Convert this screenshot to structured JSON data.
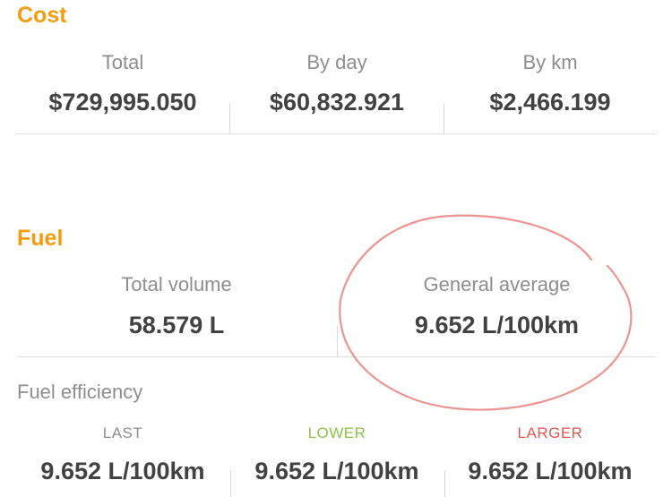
{
  "cost": {
    "title": "Cost",
    "total_label": "Total",
    "total_value": "$729,995.050",
    "by_day_label": "By day",
    "by_day_value": "$60,832.921",
    "by_km_label": "By km",
    "by_km_value": "$2,466.199"
  },
  "fuel": {
    "title": "Fuel",
    "total_volume_label": "Total volume",
    "total_volume_value": "58.579 L",
    "general_average_label": "General average",
    "general_average_value": "9.652 L/100km"
  },
  "efficiency": {
    "title": "Fuel efficiency",
    "last_label": "LAST",
    "last_value": "9.652 L/100km",
    "lower_label": "LOWER",
    "lower_value": "9.652 L/100km",
    "larger_label": "LARGER",
    "larger_value": "9.652 L/100km"
  },
  "colors": {
    "accent": "#f39c12",
    "label_gray": "#8e8e8e",
    "value_dark": "#424242",
    "lower_green": "#8bc34a",
    "larger_red": "#e05a4f",
    "annotation_stroke": "#e8837d"
  }
}
